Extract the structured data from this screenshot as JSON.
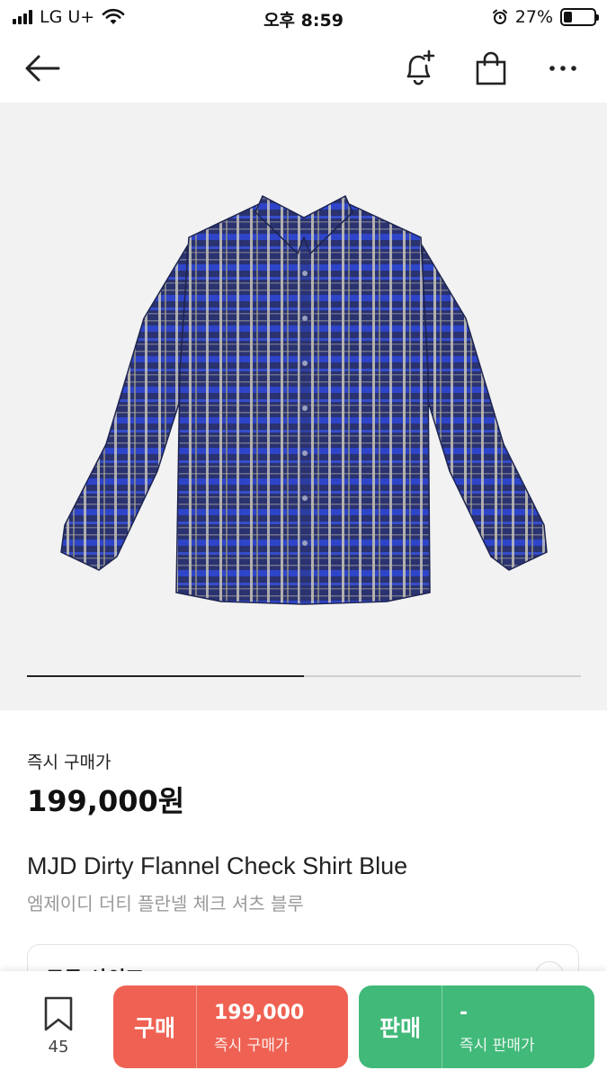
{
  "status_bar": {
    "carrier": "LG U+",
    "time": "오후 8:59",
    "battery": "27%",
    "battery_level": 0.27
  },
  "nav": {
    "back_icon": "arrow-left-icon",
    "notify_icon": "bell-plus-icon",
    "bag_icon": "shopping-bag-icon",
    "more_icon": "more-dots-icon"
  },
  "carousel": {
    "current_page": 1,
    "total_pages": 2
  },
  "product": {
    "price_label": "즉시 구매가",
    "price": "199,000원",
    "name_en": "MJD Dirty Flannel Check Shirt Blue",
    "name_kr": "엠제이디 더티 플란넬 체크 셔츠 블루"
  },
  "size_selector": {
    "label": "모든 사이즈"
  },
  "bottom_bar": {
    "wish_count": "45",
    "buy": {
      "label": "구매",
      "price": "199,000",
      "sub": "즉시 구매가",
      "color": "#ef6253"
    },
    "sell": {
      "label": "판매",
      "price": "-",
      "sub": "즉시 판매가",
      "color": "#41b979"
    }
  }
}
